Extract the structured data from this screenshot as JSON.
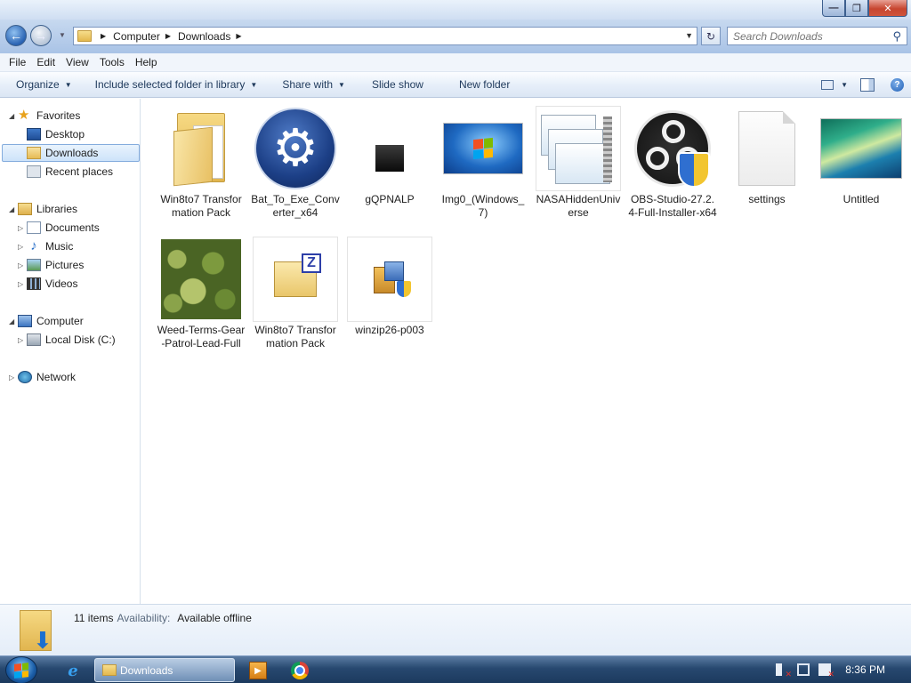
{
  "window": {
    "minimize_label": "—",
    "maximize_label": "❐",
    "close_label": "✕"
  },
  "nav": {
    "back_label": "←",
    "forward_label": "→",
    "breadcrumb": [
      "Computer",
      "Downloads"
    ],
    "search_placeholder": "Search Downloads"
  },
  "menu": [
    "File",
    "Edit",
    "View",
    "Tools",
    "Help"
  ],
  "commands": {
    "organize": "Organize",
    "include_library": "Include selected folder in library",
    "share_with": "Share with",
    "slide_show": "Slide show",
    "new_folder": "New folder",
    "help": "?"
  },
  "sidebar": {
    "favorites": "Favorites",
    "favorites_items": [
      "Desktop",
      "Downloads",
      "Recent places"
    ],
    "libraries": "Libraries",
    "library_items": [
      "Documents",
      "Music",
      "Pictures",
      "Videos"
    ],
    "computer": "Computer",
    "computer_items": [
      "Local Disk (C:)"
    ],
    "network": "Network",
    "selected": "Downloads"
  },
  "files": [
    {
      "name": "Win8to7 Transformation Pack",
      "icon": "folder-icon"
    },
    {
      "name": "Bat_To_Exe_Converter_x64",
      "icon": "gear-app-icon"
    },
    {
      "name": "gQPNALP",
      "icon": "black-square-icon"
    },
    {
      "name": "Img0_(Windows_7)",
      "icon": "windows7-wallpaper-thumbnail"
    },
    {
      "name": "NASAHiddenUniverse",
      "icon": "zip-archive-icon"
    },
    {
      "name": "OBS-Studio-27.2.4-Full-Installer-x64",
      "icon": "obs-installer-icon"
    },
    {
      "name": "settings",
      "icon": "blank-document-icon"
    },
    {
      "name": "Untitled",
      "icon": "vista-wallpaper-thumbnail"
    },
    {
      "name": "Weed-Terms-Gear-Patrol-Lead-Full",
      "icon": "photo-thumbnail"
    },
    {
      "name": "Win8to7 Transformation Pack",
      "icon": "zip-folder-icon"
    },
    {
      "name": "winzip26-p003",
      "icon": "installer-icon"
    }
  ],
  "details": {
    "count": "11 items",
    "availability_label": "Availability:",
    "availability_value": "Available offline"
  },
  "taskbar": {
    "active_window": "Downloads",
    "clock": "8:36 PM",
    "ie_label": "e"
  }
}
